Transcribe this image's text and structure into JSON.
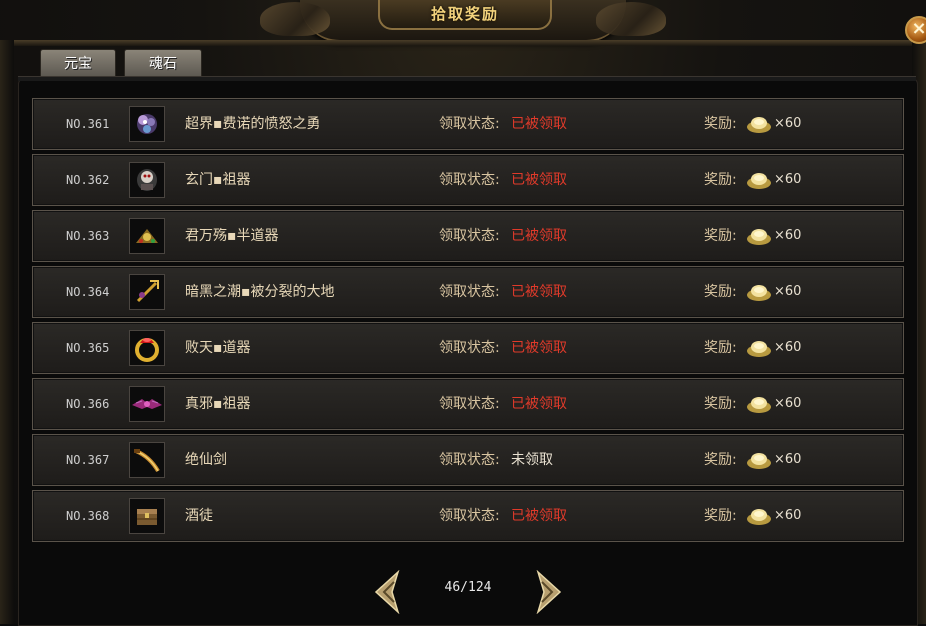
{
  "window": {
    "title": "拾取奖励",
    "close_label": "×"
  },
  "tabs": [
    {
      "label": "元宝"
    },
    {
      "label": "魂石"
    }
  ],
  "status_label": "领取状态:",
  "reward_label": "奖励:",
  "rows": [
    {
      "no": "NO.361",
      "name": "超界▪费诺的愤怒之勇",
      "status": "已被领取",
      "reward": "×60",
      "icon": "flower-ring-icon"
    },
    {
      "no": "NO.362",
      "name": "玄门▪祖器",
      "status": "已被领取",
      "reward": "×60",
      "icon": "skull-armor-icon"
    },
    {
      "no": "NO.363",
      "name": "君万殇▪半道器",
      "status": "已被领取",
      "reward": "×60",
      "icon": "golden-ornament-icon"
    },
    {
      "no": "NO.364",
      "name": "暗黑之潮▪被分裂的大地",
      "status": "已被领取",
      "reward": "×60",
      "icon": "golden-staff-icon"
    },
    {
      "no": "NO.365",
      "name": "败天▪道器",
      "status": "已被领取",
      "reward": "×60",
      "icon": "ruby-ring-icon"
    },
    {
      "no": "NO.366",
      "name": "真邪▪祖器",
      "status": "已被领取",
      "reward": "×60",
      "icon": "winged-crown-icon"
    },
    {
      "no": "NO.367",
      "name": "绝仙剑",
      "status": "未领取",
      "reward": "×60",
      "icon": "curved-sword-icon"
    },
    {
      "no": "NO.368",
      "name": "酒徒",
      "status": "已被领取",
      "reward": "×60",
      "icon": "chest-icon"
    }
  ],
  "pager": {
    "text": "46/124"
  },
  "colors": {
    "claimed": "#e03a2a",
    "unclaimed": "#e8e0d0",
    "title": "#f2d27c"
  }
}
